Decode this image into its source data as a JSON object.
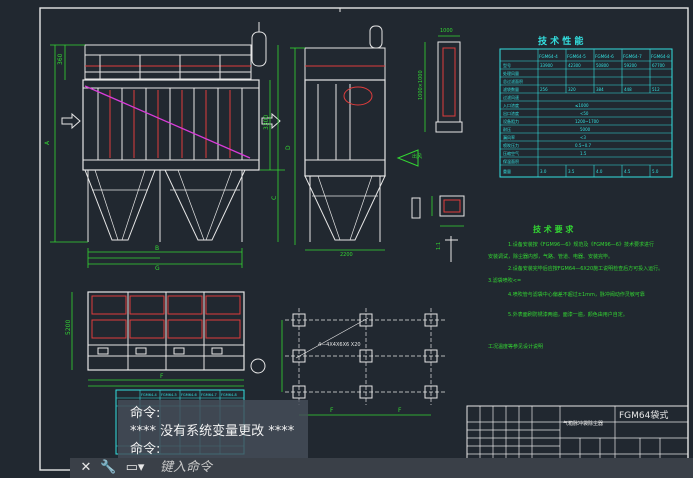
{
  "drawing": {
    "title_block": {
      "title": "FGM64袋式",
      "sheet_label": "气箱脉冲袋除尘器"
    },
    "tech_params": {
      "title": "技 术 性 能",
      "models": [
        "FGM64-4",
        "FGM64-5",
        "FGM64-6",
        "FGM64-7",
        "FGM64-8"
      ]
    },
    "tech_req": {
      "title": "技 术 要 求",
      "lines": [
        "1.设备安装按《FGM96—6》规范及《FGM96—6》技术要求进行",
        "安装调试，除尘器内部，气路、管道、电器、安装完毕。",
        "2.设备安装完毕后应按FGM64—6X20施工说明检查后方可投入运行。",
        "3.滤袋喷吹<=",
        "4.喷吹管与滤袋中心偏差不超过±1mm，脉冲阀动作灵敏可靠",
        "5.外表面刷防锈漆两遍，面漆一遍，颜色由用户自定。",
        "工况温度等参见设计说明"
      ]
    },
    "plan_label": "4—4X4X6X6 X20"
  },
  "command_window": {
    "line1": "命令:",
    "line2": "**** 没有系统变量更改 ****",
    "line3": "命令:",
    "input_placeholder": "键入命令"
  },
  "colors": {
    "background": "#212830",
    "drawing_white": "#e6e6e6",
    "dimension_green": "#33d633",
    "table_cyan": "#33e0e0",
    "accent_red": "#e03c3c",
    "magenta": "#d83cd8"
  }
}
